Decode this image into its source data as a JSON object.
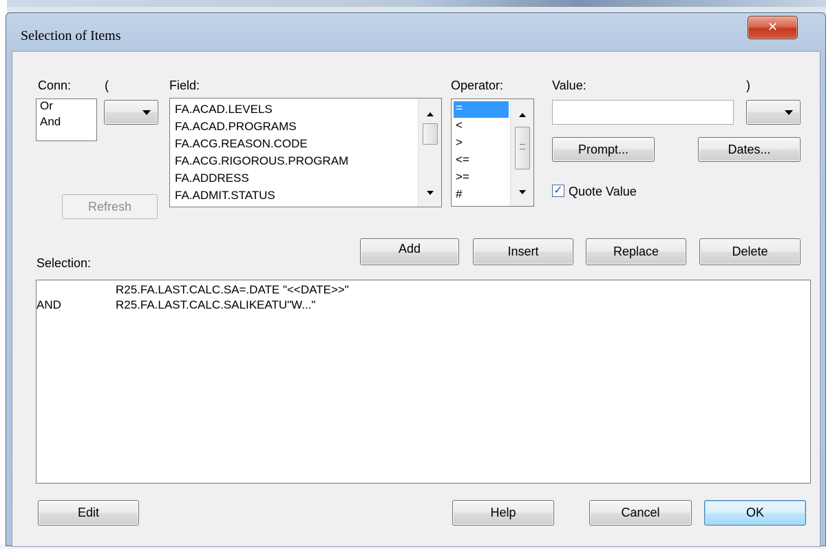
{
  "window": {
    "title": "Selection of Items",
    "close_icon": "close-icon"
  },
  "conn": {
    "label": "Conn:",
    "items": [
      "Or",
      "And"
    ]
  },
  "open_paren": {
    "label": "("
  },
  "field": {
    "label": "Field:",
    "items": [
      "FA.ACAD.LEVELS",
      "FA.ACAD.PROGRAMS",
      "FA.ACG.REASON.CODE",
      "FA.ACG.RIGOROUS.PROGRAM",
      "FA.ADDRESS",
      "FA.ADMIT.STATUS"
    ]
  },
  "operator": {
    "label": "Operator:",
    "items": [
      "=",
      "<",
      ">",
      "<=",
      ">=",
      "#"
    ],
    "selected": "="
  },
  "value": {
    "label": "Value:",
    "text": ""
  },
  "close_paren": {
    "label": ")"
  },
  "buttons": {
    "refresh": "Refresh",
    "prompt": "Prompt...",
    "dates": "Dates...",
    "add": "Add",
    "insert": "Insert",
    "replace": "Replace",
    "delete": "Delete",
    "edit": "Edit",
    "help": "Help",
    "cancel": "Cancel",
    "ok": "OK"
  },
  "quote_value": {
    "label": "Quote Value",
    "checked": true
  },
  "selection": {
    "label": "Selection:",
    "rows": [
      {
        "conn": "",
        "expr": "R25.FA.LAST.CALC.SA=.DATE \"<<DATE>>\""
      },
      {
        "conn": "AND",
        "expr": "R25.FA.LAST.CALC.SALIKEATU\"W...\""
      }
    ]
  }
}
